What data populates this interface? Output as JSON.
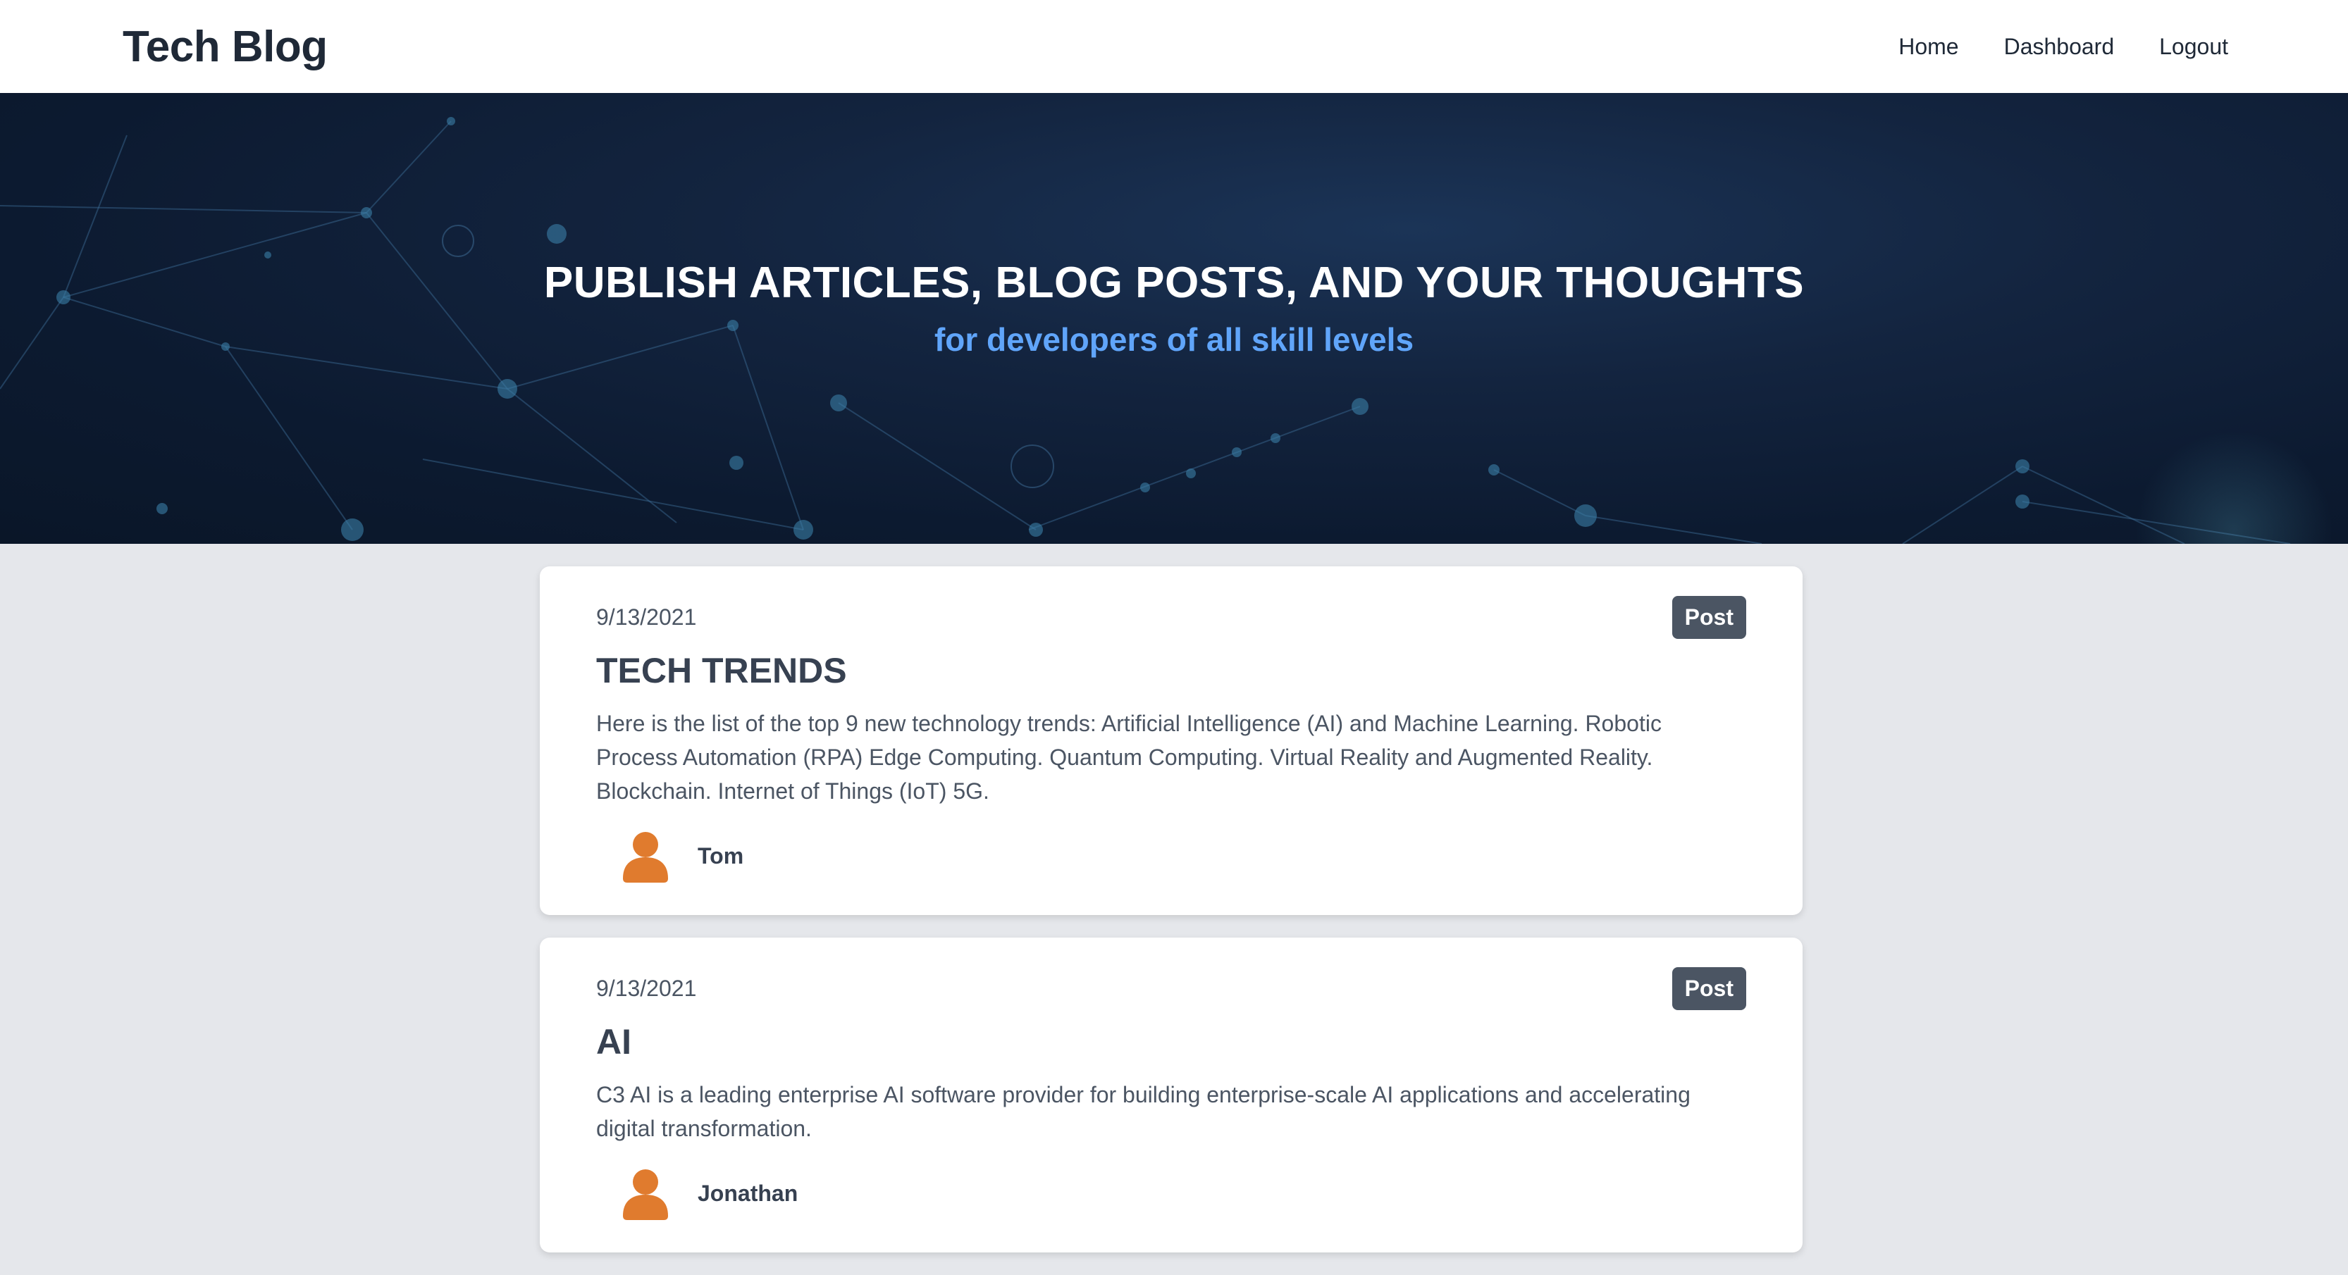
{
  "navbar": {
    "brand": "Tech Blog",
    "links": [
      "Home",
      "Dashboard",
      "Logout"
    ]
  },
  "hero": {
    "title": "PUBLISH ARTICLES, BLOG POSTS, AND YOUR THOUGHTS",
    "subtitle": "for developers of all skill levels"
  },
  "posts": [
    {
      "date": "9/13/2021",
      "badge": "Post",
      "title": "TECH TRENDS",
      "body": "Here is the list of the top 9 new technology trends: Artificial Intelligence (AI) and Machine Learning. Robotic Process Automation (RPA) Edge Computing. Quantum Computing. Virtual Reality and Augmented Reality. Blockchain. Internet of Things (IoT) 5G.",
      "author": "Tom",
      "avatar_icon": "user-avatar-icon"
    },
    {
      "date": "9/13/2021",
      "badge": "Post",
      "title": "AI",
      "body": "C3 AI is a leading enterprise AI software provider for building enterprise-scale AI applications and accelerating digital transformation.",
      "author": "Jonathan",
      "avatar_icon": "user-avatar-icon"
    }
  ],
  "colors": {
    "hero_subtitle": "#60a5fa",
    "avatar": "#e07b2e",
    "badge": "#4b5563",
    "page_bg": "#e5e7eb"
  }
}
